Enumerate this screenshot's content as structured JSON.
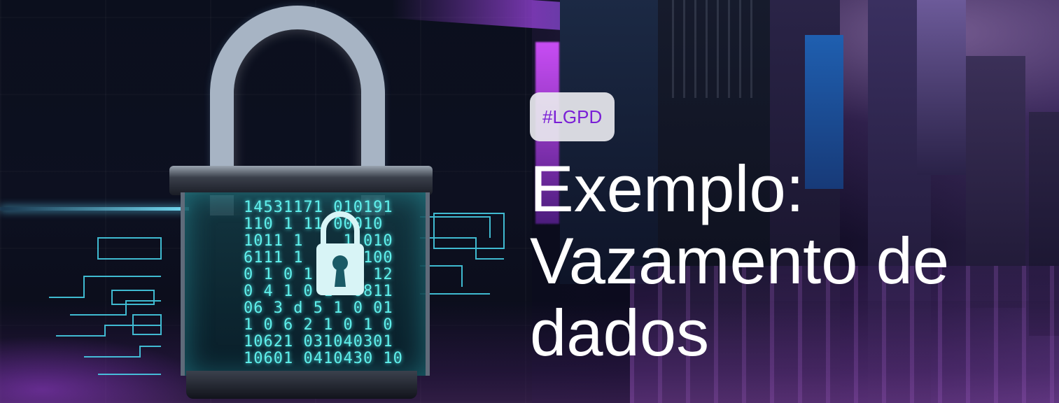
{
  "hero": {
    "tag_label": "#LGPD",
    "title": "Exemplo: Vazamento de dados"
  },
  "illustration": {
    "binary_lines": [
      "14531171 010191",
      "110 1 11 00010",
      "1011 1    11010",
      "6111 1   110100",
      "0 1 0 1  016 12",
      "0 4 1 0 1  0811",
      "06 3 d 5 1 0 01",
      "1 0 6 2 1 0 1 0",
      "10621 031040301",
      "10601 0410430 10"
    ],
    "icons": [
      "padlock-icon",
      "keyhole-icon"
    ]
  },
  "colors": {
    "tag_background": "#e8e8ee",
    "tag_text": "#7a1fd6",
    "title_text": "#ffffff",
    "neon_cyan": "#5ff0ec",
    "neon_purple": "#c050ff"
  }
}
